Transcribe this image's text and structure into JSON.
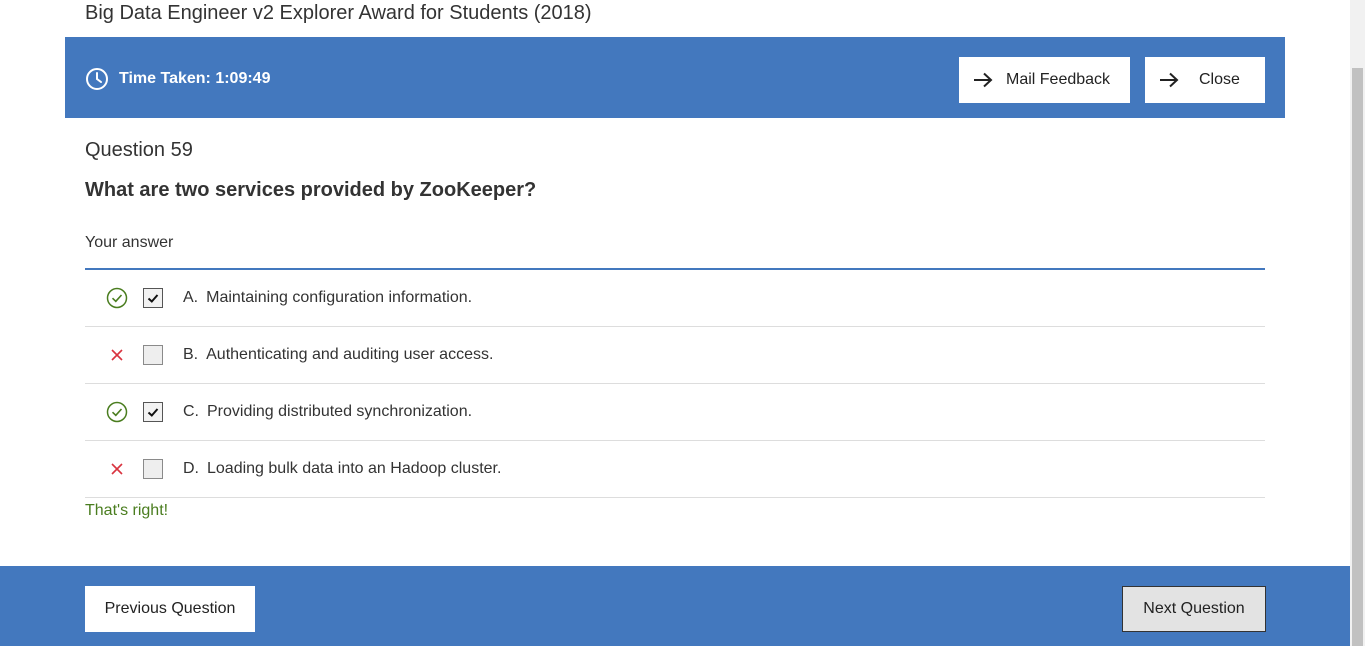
{
  "page": {
    "title": "Big Data Engineer v2 Explorer Award for Students (2018)"
  },
  "header": {
    "time_label": "Time Taken: 1:09:49",
    "clock_icon": "clock-icon",
    "mail_feedback_label": "Mail Feedback",
    "close_label": "Close",
    "arrow_icon": "arrow-right-icon",
    "bar_color": "#4378be"
  },
  "question": {
    "number_label": "Question 59",
    "text": "What are two services provided by ZooKeeper?",
    "your_answer_label": "Your answer",
    "options": [
      {
        "letter": "A.",
        "text": "Maintaining configuration information.",
        "checked": true,
        "correct": true
      },
      {
        "letter": "B.",
        "text": "Authenticating and auditing user access.",
        "checked": false,
        "correct": false
      },
      {
        "letter": "C.",
        "text": "Providing distributed synchronization.",
        "checked": true,
        "correct": true
      },
      {
        "letter": "D.",
        "text": "Loading bulk data into an Hadoop cluster.",
        "checked": false,
        "correct": false
      }
    ],
    "feedback": "That's right!",
    "colors": {
      "correct": "#4a7d1f",
      "wrong": "#d9333f",
      "feedback": "#4a7d1f"
    }
  },
  "footer": {
    "previous_label": "Previous Question",
    "next_label": "Next Question"
  }
}
